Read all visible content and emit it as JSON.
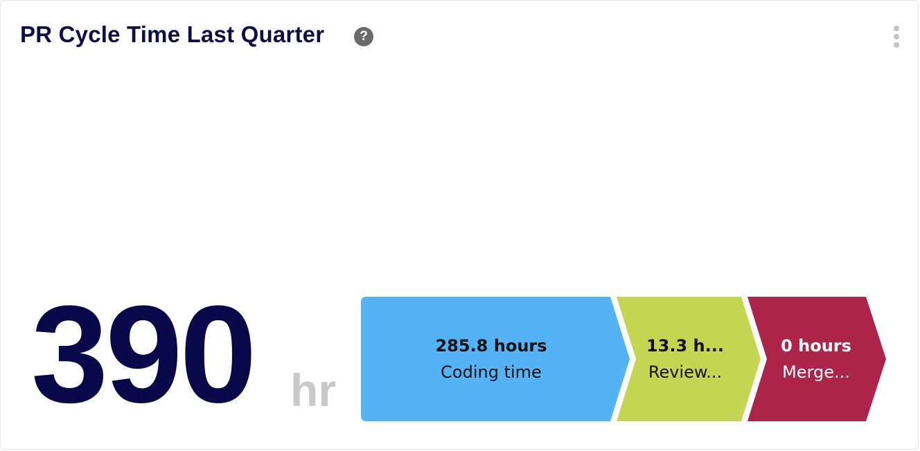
{
  "widget": {
    "title": "PR Cycle Time Last Quarter",
    "help_icon": "question-circle-icon",
    "help_glyph": "?",
    "menu_icon": "vertical-ellipsis-icon"
  },
  "summary": {
    "value": "390",
    "unit": "hr"
  },
  "stages": [
    {
      "value": "285.8 hours",
      "label": "Coding time",
      "color": "#54b3f5",
      "text_color": "#111111"
    },
    {
      "value": "13.3 h...",
      "label": "Review...",
      "color": "#c4d651",
      "text_color": "#111111"
    },
    {
      "value": "0 hours",
      "label": "Merge...",
      "color": "#ad2449",
      "text_color": "#ffffff"
    }
  ]
}
